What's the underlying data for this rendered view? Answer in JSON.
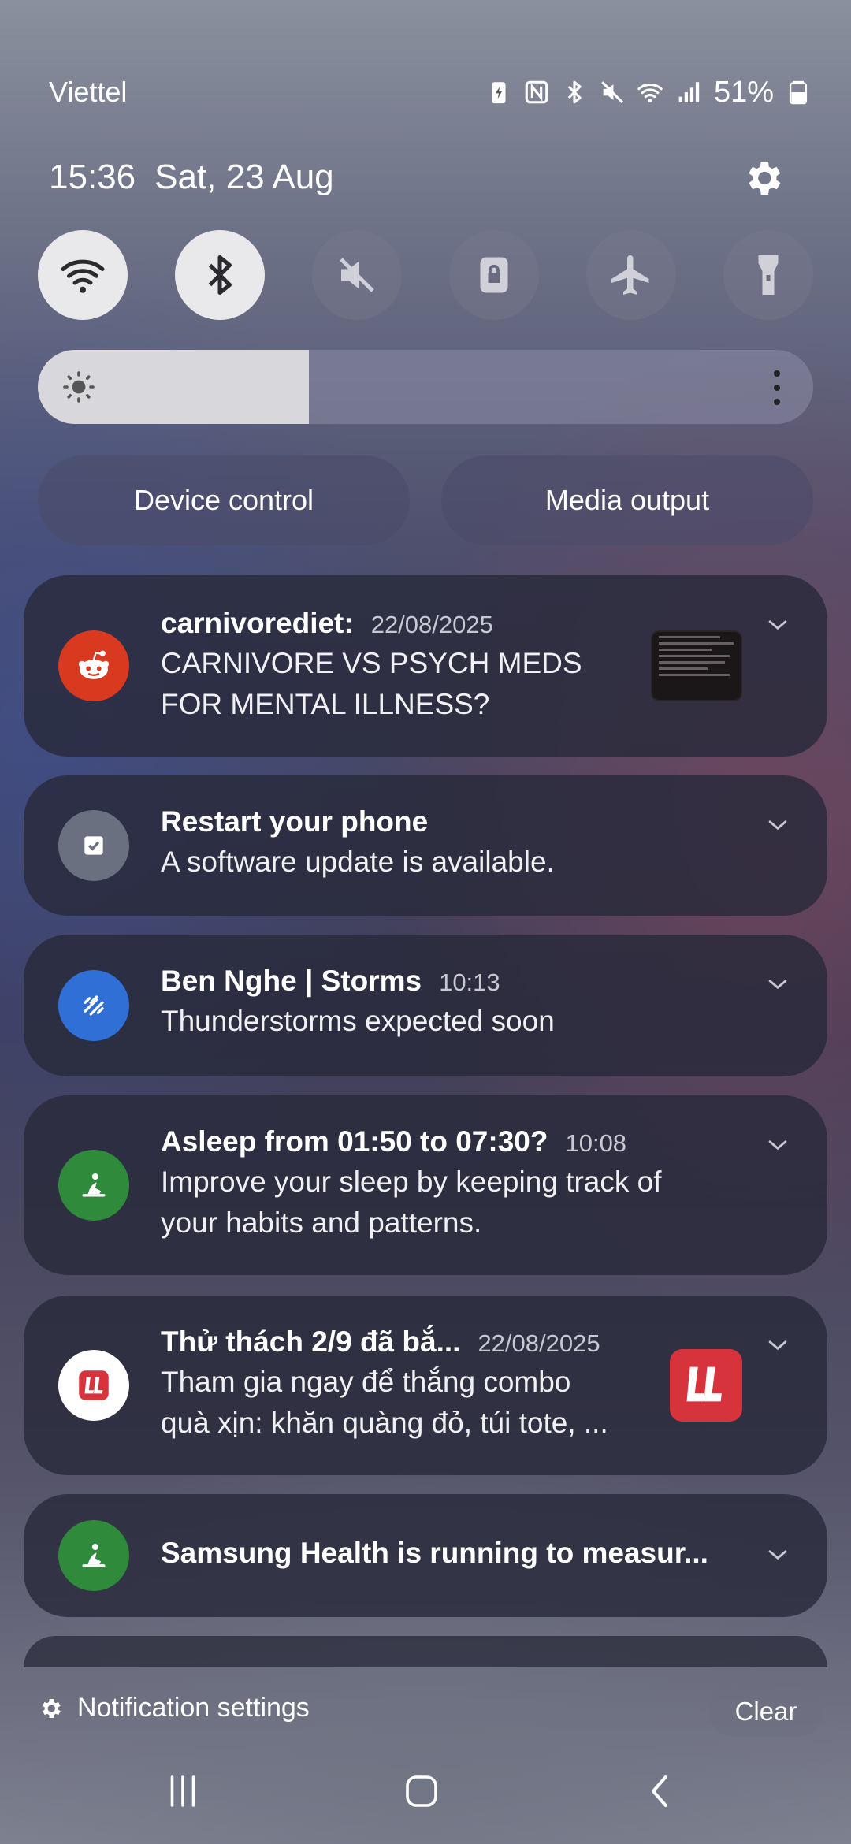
{
  "status_bar": {
    "carrier": "Viettel",
    "battery": "51%",
    "icons": [
      "battery-saver-icon",
      "nfc-icon",
      "bluetooth-icon",
      "mute-icon",
      "wifi-icon",
      "signal-icon",
      "battery-icon"
    ]
  },
  "header": {
    "time": "15:36",
    "date": "Sat, 23 Aug"
  },
  "quick_settings": [
    {
      "name": "wifi",
      "icon": "wifi-icon",
      "on": true
    },
    {
      "name": "bluetooth",
      "icon": "bluetooth-icon",
      "on": true
    },
    {
      "name": "sound",
      "icon": "mute-icon",
      "on": false
    },
    {
      "name": "rotation-lock",
      "icon": "lock-icon",
      "on": false
    },
    {
      "name": "airplane",
      "icon": "airplane-icon",
      "on": false
    },
    {
      "name": "flashlight",
      "icon": "flashlight-icon",
      "on": false
    }
  ],
  "brightness": {
    "level": 0.35
  },
  "buttons": {
    "device_control": "Device control",
    "media_output": "Media output"
  },
  "notifications": [
    {
      "app": "reddit",
      "title": "carnivorediet:",
      "time": "22/08/2025",
      "text": [
        "CARNIVORE VS PSYCH MEDS",
        "FOR MENTAL ILLNESS?"
      ],
      "icon": "reddit-icon"
    },
    {
      "app": "software-update",
      "title": "Restart your phone",
      "time": "",
      "text": [
        "A software update is available."
      ],
      "icon": "update-icon"
    },
    {
      "app": "weather",
      "title": "Ben Nghe | Storms",
      "time": "10:13",
      "text": [
        "Thunderstorms expected soon"
      ],
      "icon": "rain-icon"
    },
    {
      "app": "samsung-health",
      "title": "Asleep from 01:50 to 07:30?",
      "time": "10:08",
      "text": [
        "Improve your sleep by keeping track of",
        "your habits and patterns."
      ],
      "icon": "health-icon"
    },
    {
      "app": "ll",
      "title": "Thử thách 2/9 đã bắ...",
      "time": "22/08/2025",
      "text": [
        "Tham gia ngay để thắng combo",
        "quà xịn: khăn quàng đỏ, túi tote, ..."
      ],
      "icon": "ll-logo-icon"
    },
    {
      "app": "samsung-health",
      "title": "Samsung Health is running to measur...",
      "time": "",
      "text": [],
      "icon": "health-icon"
    }
  ],
  "footer": {
    "notification_settings": "Notification settings",
    "clear": "Clear"
  },
  "colors": {
    "reddit": "#d93a1f",
    "update": "#6b7080",
    "weather": "#2f6fd6",
    "health": "#2f8a3c",
    "ll": "#d6333d"
  }
}
